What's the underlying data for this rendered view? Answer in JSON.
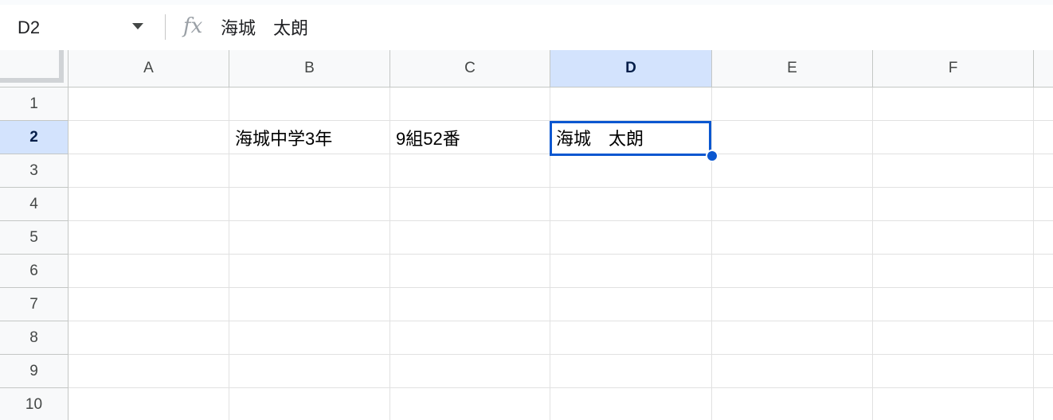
{
  "formula_bar": {
    "name_box": "D2",
    "fx_label": "fx",
    "formula": "海城　太朗"
  },
  "columns": [
    "A",
    "B",
    "C",
    "D",
    "E",
    "F"
  ],
  "rows": [
    "1",
    "2",
    "3",
    "4",
    "5",
    "6",
    "7",
    "8",
    "9",
    "10"
  ],
  "selected_cell": {
    "column": "D",
    "row": "2"
  },
  "cells": {
    "B2": "海城中学3年",
    "C2": "9組52番",
    "D2": "海城　太朗"
  },
  "colors": {
    "selection": "#0b57d0",
    "header_selected": "#d3e3fd",
    "header_bg": "#f8f9fa"
  }
}
